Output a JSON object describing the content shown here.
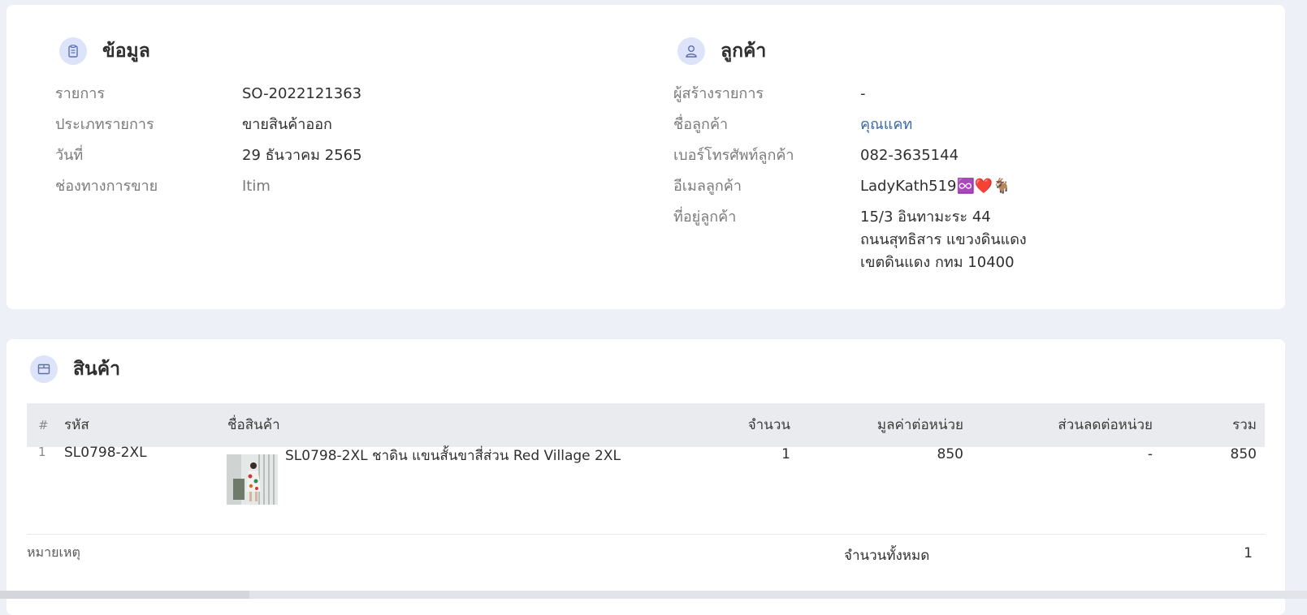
{
  "info": {
    "title": "ข้อมูล",
    "rows": [
      {
        "label": "รายการ",
        "value": "SO-2022121363"
      },
      {
        "label": "ประเภทรายการ",
        "value": "ขายสินค้าออก"
      },
      {
        "label": "วันที่",
        "value": "29 ธันวาคม 2565"
      },
      {
        "label": "ช่องทางการขาย",
        "value": "Itim"
      }
    ]
  },
  "customer": {
    "title": "ลูกค้า",
    "rows": [
      {
        "label": "ผู้สร้างรายการ",
        "value": "-"
      },
      {
        "label": "ชื่อลูกค้า",
        "value": "คุณแคท"
      },
      {
        "label": "เบอร์โทรศัพท์ลูกค้า",
        "value": "082-3635144"
      },
      {
        "label": "อีเมลลูกค้า",
        "value": "LadyKath519♾️❤️🐐"
      },
      {
        "label": "ที่อยู่ลูกค้า",
        "value_lines": [
          "15/3 อินทามะระ 44",
          "ถนนสุทธิสาร แขวงดินแดง",
          "เขตดินแดง กทม 10400"
        ]
      }
    ]
  },
  "products": {
    "title": "สินค้า",
    "columns": {
      "index": "#",
      "code": "รหัส",
      "name": "ชื่อสินค้า",
      "qty": "จำนวน",
      "unit_price": "มูลค่าต่อหน่วย",
      "discount": "ส่วนลดต่อหน่วย",
      "total": "รวม"
    },
    "rows": [
      {
        "index": "1",
        "code": "SL0798-2XL",
        "name": "SL0798-2XL ชาดิน แขนสั้นขาสี่ส่วน Red Village 2XL",
        "qty": "1",
        "unit_price": "850",
        "discount": "-",
        "total": "850"
      }
    ]
  },
  "footer": {
    "note_label": "หมายเหตุ",
    "total_qty_label": "จำนวนทั้งหมด",
    "total_qty_value": "1"
  }
}
